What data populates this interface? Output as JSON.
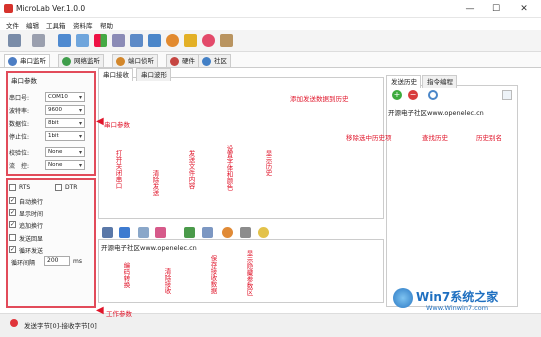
{
  "window": {
    "title": "MicroLab Ver.1.0.0",
    "minimize": "—",
    "maximize": "☐",
    "close": "✕"
  },
  "menu": [
    "文件",
    "编辑",
    "工具箱",
    "资料库",
    "帮助"
  ],
  "main_tabs": [
    "串口监听",
    "网络监听",
    "端口侦听",
    "硬件",
    "社区"
  ],
  "sub_tabs": [
    "串口接收",
    "串口波形"
  ],
  "right_tabs": [
    "发送历史",
    "指令编程"
  ],
  "serial_params": {
    "title": "串口参数",
    "rows": [
      {
        "label": "串口号:",
        "value": "COM10"
      },
      {
        "label": "波特率:",
        "value": "9600"
      },
      {
        "label": "数据位:",
        "value": "8bit"
      },
      {
        "label": "停止位:",
        "value": "1bit"
      },
      {
        "label": "校验位:",
        "value": "None"
      },
      {
        "label": "流　控:",
        "value": "None"
      }
    ]
  },
  "work_params": {
    "rts": "RTS",
    "dtr": "DTR",
    "checks": [
      {
        "label": "自动换行",
        "checked": true
      },
      {
        "label": "显示时间",
        "checked": true
      },
      {
        "label": "追加换行",
        "checked": true
      },
      {
        "label": "发送回显",
        "checked": false
      },
      {
        "label": "循环发送",
        "checked": true
      }
    ],
    "interval_label": "循环间隔",
    "interval_value": "200",
    "interval_unit": "ms"
  },
  "send_text": "开源电子社区www.openelec.cn",
  "history_item": "开源电子社区www.openelec.cn",
  "status_text": "发送字节[0]-接收字节[0]",
  "annotations": {
    "serial_params": "串口参数",
    "work_params": "工作参数",
    "add_history": "添加发送数据到历史",
    "remove_history": "移除选中历史项",
    "find_history": "查找历史",
    "history_alias": "历史别名",
    "open_close_port": "打开关闭串口",
    "clear_send": "清除发送",
    "send_file": "发送文件内容",
    "set_font_color": "设置字体和颜色",
    "show_hide_history": "显示历史",
    "hex_convert": "编码转换",
    "clear_receive": "清除接收",
    "save_receive": "保存接收数据",
    "show_hide_data": "显示隐藏参数区"
  },
  "watermark": {
    "brand": "Win7系统之家",
    "url": "Www.Winwin7.com"
  },
  "colors": {
    "accent_red": "#e0152a",
    "add_green": "#3cab3c",
    "remove_red": "#d83b3b"
  }
}
